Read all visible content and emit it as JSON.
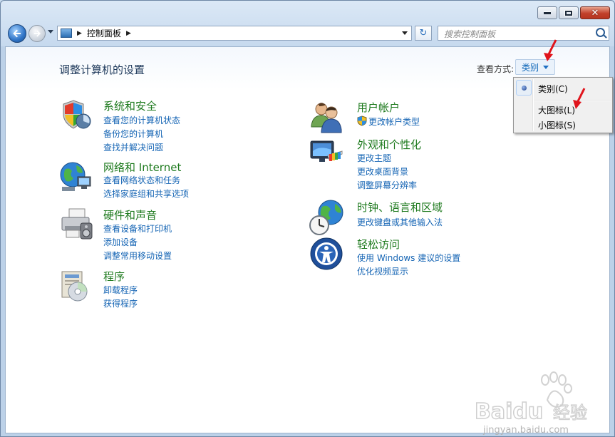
{
  "address": {
    "path": "控制面板",
    "search_placeholder": "搜索控制面板"
  },
  "header": {
    "title": "调整计算机的设置",
    "view_by_label": "查看方式:",
    "view_by_value": "类别"
  },
  "view_menu": {
    "items": [
      {
        "label": "类别(C)",
        "checked": true
      },
      {
        "label": "大图标(L)",
        "checked": false
      },
      {
        "label": "小图标(S)",
        "checked": false
      }
    ]
  },
  "categories_left": [
    {
      "title": "系统和安全",
      "links": [
        "查看您的计算机状态",
        "备份您的计算机",
        "查找并解决问题"
      ]
    },
    {
      "title": "网络和 Internet",
      "links": [
        "查看网络状态和任务",
        "选择家庭组和共享选项"
      ]
    },
    {
      "title": "硬件和声音",
      "links": [
        "查看设备和打印机",
        "添加设备",
        "调整常用移动设置"
      ]
    },
    {
      "title": "程序",
      "links": [
        "卸载程序",
        "获得程序"
      ]
    }
  ],
  "categories_right": [
    {
      "title": "用户帐户",
      "links": [
        "更改帐户类型"
      ]
    },
    {
      "title": "外观和个性化",
      "links": [
        "更改主题",
        "更改桌面背景",
        "调整屏幕分辨率"
      ]
    },
    {
      "title": "时钟、语言和区域",
      "links": [
        "更改键盘或其他输入法"
      ]
    },
    {
      "title": "轻松访问",
      "links": [
        "使用 Windows 建议的设置",
        "优化视频显示"
      ]
    }
  ],
  "watermark": {
    "brand": "Baidu",
    "brand_cn": "经验",
    "url": "jingyan.baidu.com"
  },
  "colors": {
    "category_title": "#1e7a1e",
    "link": "#1464b4",
    "annotation_arrow": "#e0141c"
  }
}
